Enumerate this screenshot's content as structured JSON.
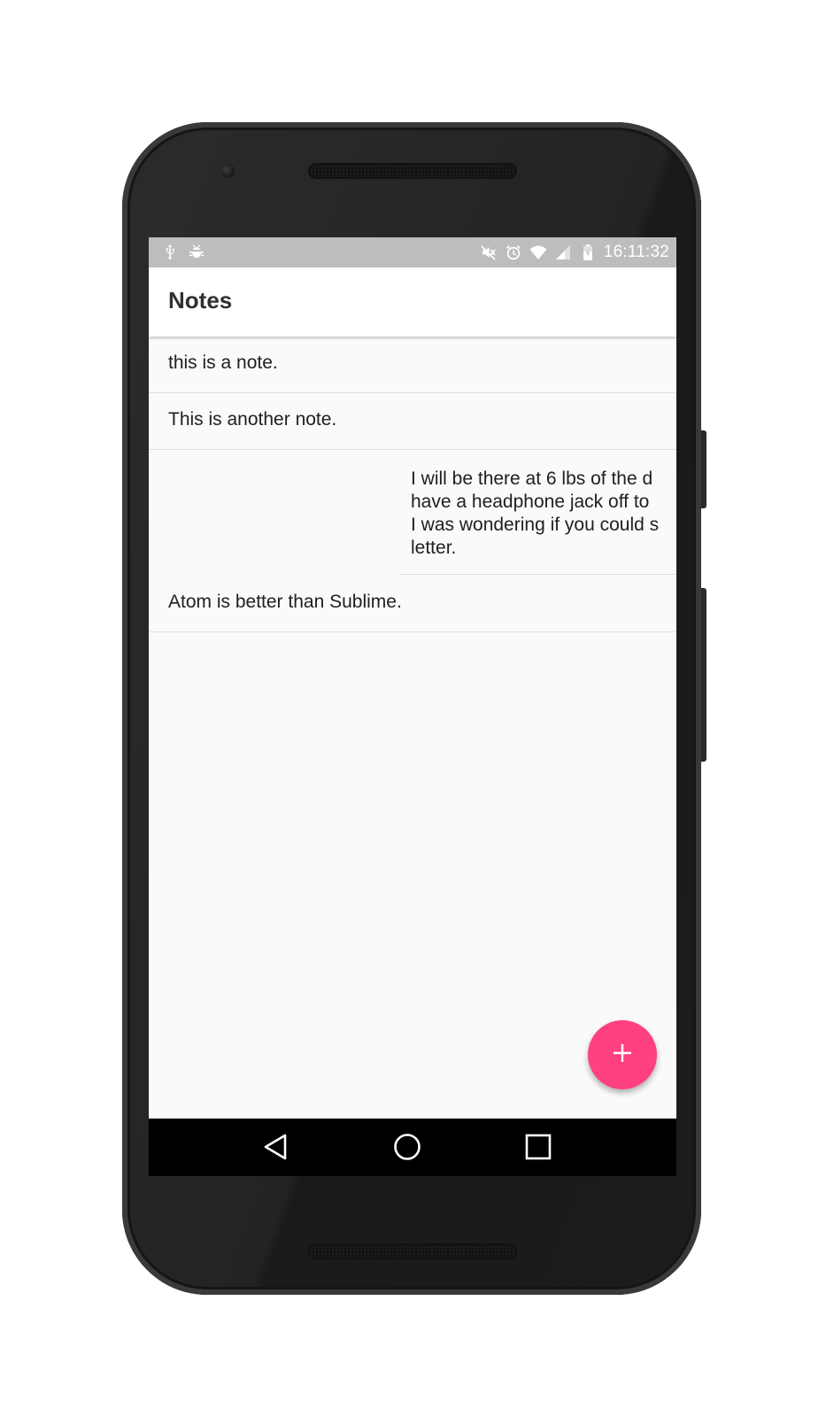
{
  "status_bar": {
    "time": "16:11:32",
    "left_icons": [
      "usb-icon",
      "android-debug-icon"
    ],
    "right_icons": [
      "mute-icon",
      "alarm-icon",
      "wifi-icon",
      "signal-icon",
      "battery-icon"
    ]
  },
  "app_bar": {
    "title": "Notes"
  },
  "notes": [
    {
      "text": "this is a note."
    },
    {
      "text": "This is another note."
    },
    {
      "text": "I will be there at 6 lbs of the d\nhave a headphone jack off to\nI was wondering if you could s\nletter."
    },
    {
      "text": "Atom is better than Sublime."
    }
  ],
  "fab": {
    "icon": "plus-icon",
    "color": "#ff4081"
  },
  "nav_bar": {
    "icons": [
      "back-icon",
      "home-icon",
      "recent-apps-icon"
    ]
  },
  "colors": {
    "accent": "#ff4081",
    "status_bar": "#bdbdbd",
    "background": "#fafafa"
  }
}
